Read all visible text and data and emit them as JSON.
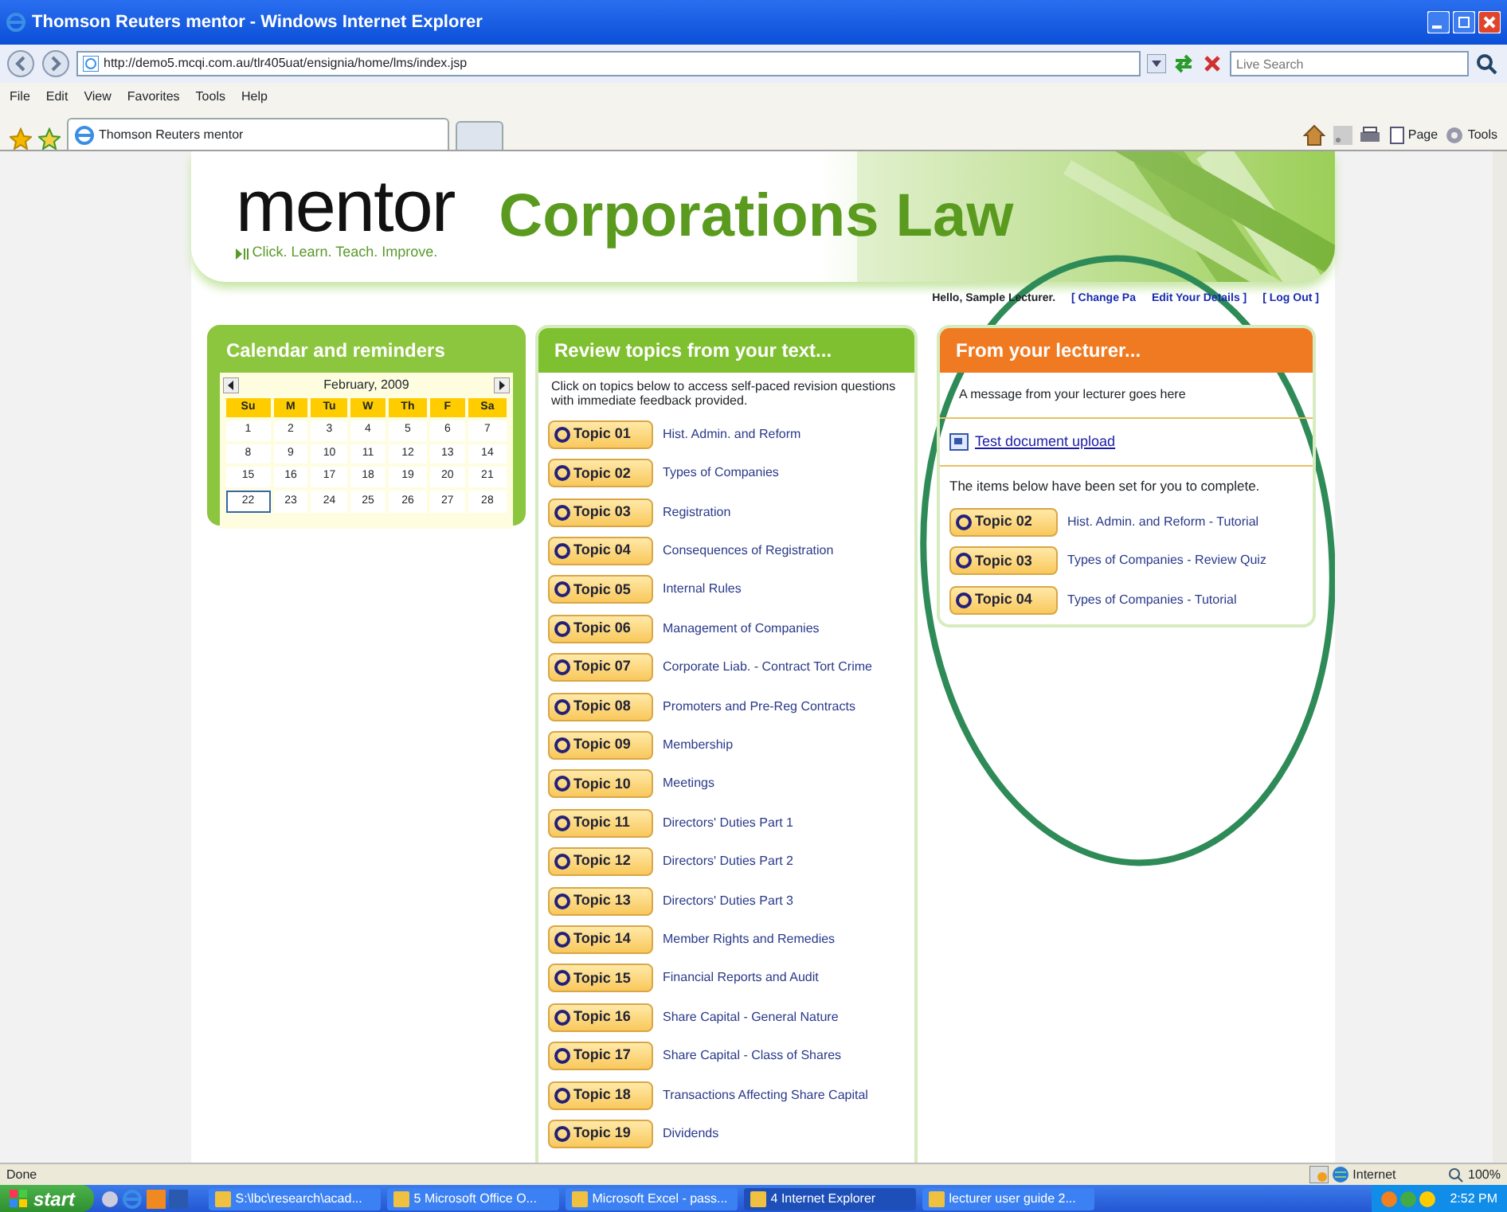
{
  "browser": {
    "title": "Thomson Reuters mentor - Windows Internet Explorer",
    "address": "http://demo5.mcqi.com.au/tlr405uat/ensignia/home/lms/index.jsp",
    "search_placeholder": "Live Search",
    "menu": [
      "File",
      "Edit",
      "View",
      "Favorites",
      "Tools",
      "Help"
    ],
    "tab": "Thomson Reuters mentor",
    "toolbar": [
      "Page",
      "Tools"
    ]
  },
  "header": {
    "logo": "mentor",
    "tagline": "Click. Learn. Teach. Improve.",
    "course": "Corporations Law",
    "greeting": "Hello, Sample Lecturer.",
    "links": [
      "[ Change Pa",
      "Edit Your Details ]",
      "[ Log Out ]"
    ]
  },
  "calendar": {
    "title": "Calendar and reminders",
    "month": "February, 2009",
    "weekdays": [
      "Su",
      "M",
      "Tu",
      "W",
      "Th",
      "F",
      "Sa"
    ],
    "weeks": [
      [
        {
          "day": "1",
          "selected": false
        },
        {
          "day": "2",
          "selected": false
        },
        {
          "day": "3",
          "selected": false
        },
        {
          "day": "4",
          "selected": false
        },
        {
          "day": "5",
          "selected": false
        },
        {
          "day": "6",
          "selected": false
        },
        {
          "day": "7",
          "selected": false
        }
      ],
      [
        {
          "day": "8",
          "selected": false
        },
        {
          "day": "9",
          "selected": false
        },
        {
          "day": "10",
          "selected": false
        },
        {
          "day": "11",
          "selected": false
        },
        {
          "day": "12",
          "selected": false
        },
        {
          "day": "13",
          "selected": false
        },
        {
          "day": "14",
          "selected": false
        }
      ],
      [
        {
          "day": "15",
          "selected": false
        },
        {
          "day": "16",
          "selected": false
        },
        {
          "day": "17",
          "selected": false
        },
        {
          "day": "18",
          "selected": false
        },
        {
          "day": "19",
          "selected": false
        },
        {
          "day": "20",
          "selected": false
        },
        {
          "day": "21",
          "selected": false
        }
      ],
      [
        {
          "day": "22",
          "selected": true
        },
        {
          "day": "23",
          "selected": false
        },
        {
          "day": "24",
          "selected": false
        },
        {
          "day": "25",
          "selected": false
        },
        {
          "day": "26",
          "selected": false
        },
        {
          "day": "27",
          "selected": false
        },
        {
          "day": "28",
          "selected": false
        }
      ]
    ]
  },
  "review": {
    "title": "Review topics from your text...",
    "intro": "Click on topics below to access self-paced revision questions with immediate feedback provided.",
    "topics": [
      {
        "code": "Topic 01",
        "title": "Hist. Admin. and Reform"
      },
      {
        "code": "Topic 02",
        "title": "Types of Companies"
      },
      {
        "code": "Topic 03",
        "title": "Registration"
      },
      {
        "code": "Topic 04",
        "title": "Consequences of Registration"
      },
      {
        "code": "Topic 05",
        "title": "Internal Rules"
      },
      {
        "code": "Topic 06",
        "title": "Management of Companies"
      },
      {
        "code": "Topic 07",
        "title": "Corporate Liab. - Contract Tort Crime"
      },
      {
        "code": "Topic 08",
        "title": "Promoters and Pre-Reg Contracts"
      },
      {
        "code": "Topic 09",
        "title": "Membership"
      },
      {
        "code": "Topic 10",
        "title": "Meetings"
      },
      {
        "code": "Topic 11",
        "title": "Directors' Duties Part 1"
      },
      {
        "code": "Topic 12",
        "title": "Directors' Duties Part 2"
      },
      {
        "code": "Topic 13",
        "title": "Directors' Duties Part 3"
      },
      {
        "code": "Topic 14",
        "title": "Member Rights and Remedies"
      },
      {
        "code": "Topic 15",
        "title": "Financial Reports and Audit"
      },
      {
        "code": "Topic 16",
        "title": "Share Capital - General Nature"
      },
      {
        "code": "Topic 17",
        "title": "Share Capital - Class of Shares"
      },
      {
        "code": "Topic 18",
        "title": "Transactions Affecting Share Capital"
      },
      {
        "code": "Topic 19",
        "title": "Dividends"
      }
    ]
  },
  "lecturer": {
    "title": "From your lecturer...",
    "message": "A message from your lecturer goes here",
    "document": "Test document upload",
    "note": "The items below have been set for you to complete.",
    "items": [
      {
        "code": "Topic 02",
        "title": "Hist. Admin. and Reform - Tutorial"
      },
      {
        "code": "Topic 03",
        "title": "Types of Companies - Review Quiz"
      },
      {
        "code": "Topic 04",
        "title": "Types of Companies - Tutorial"
      }
    ]
  },
  "status_bar": {
    "text": "Done",
    "zone": "Internet",
    "zoom": "100%"
  },
  "taskbar": {
    "start": "start",
    "tasks": [
      {
        "label": "S:\\lbc\\research\\acad...",
        "selected": false
      },
      {
        "label": "5 Microsoft Office O...",
        "selected": false
      },
      {
        "label": "Microsoft Excel - pass...",
        "selected": false
      },
      {
        "label": "4 Internet Explorer",
        "selected": true
      },
      {
        "label": "lecturer user guide 2...",
        "selected": false
      }
    ],
    "clock": "2:52 PM"
  },
  "annotation": {
    "kind": "ellipse"
  }
}
